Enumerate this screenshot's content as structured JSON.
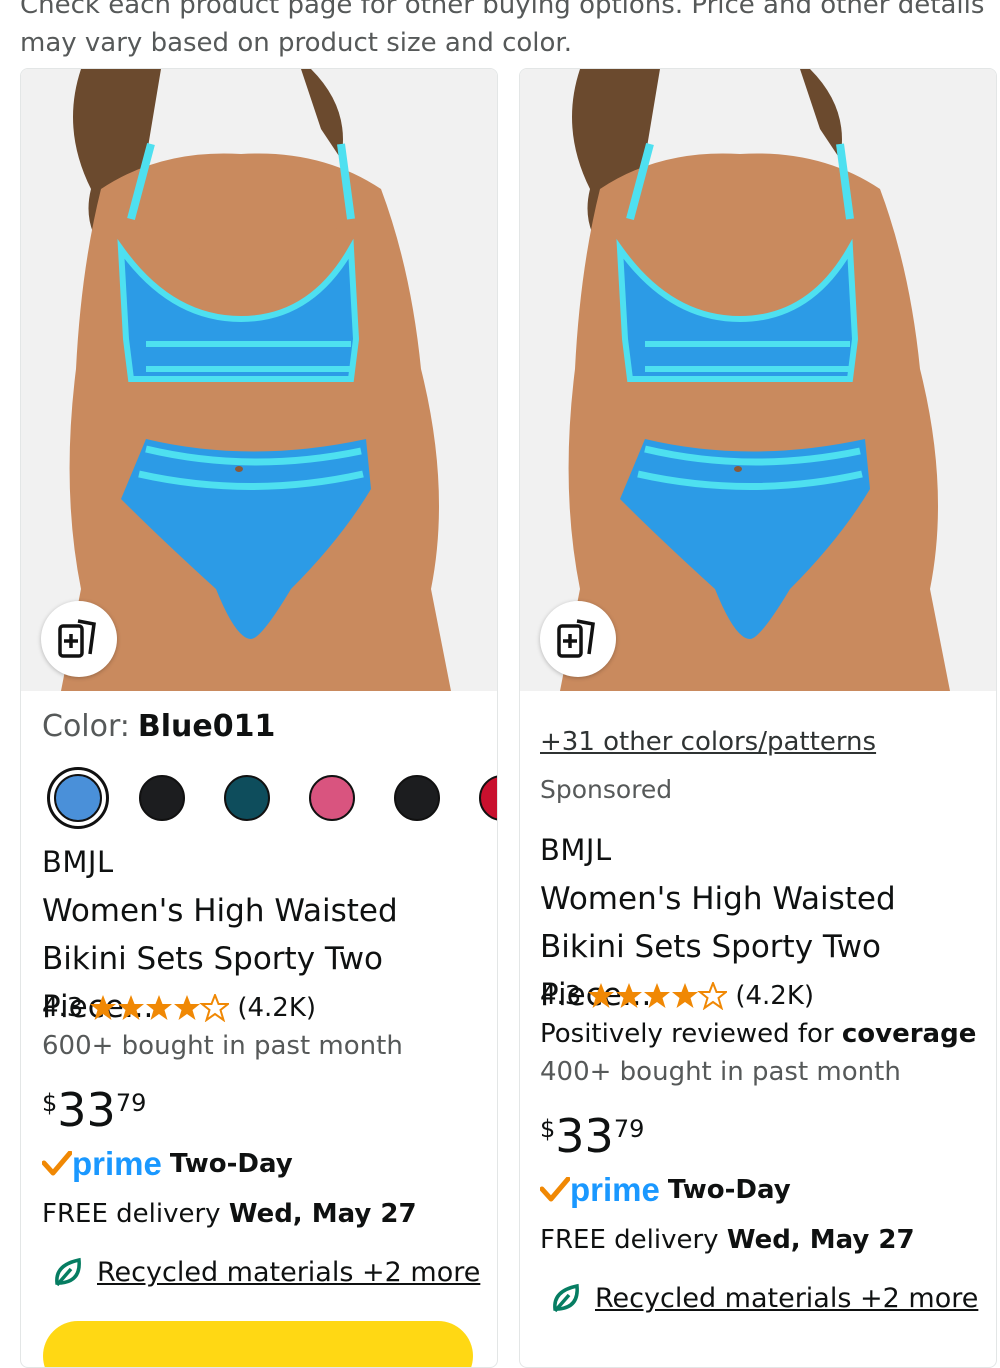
{
  "notice": "Check each product page for other buying options. Price and other details may vary based on product size and color.",
  "left": {
    "compare_icon": "compare-add-icon",
    "color_label": "Color:",
    "color_value": "Blue011",
    "swatches": [
      {
        "color": "#4a90d9",
        "selected": true
      },
      {
        "color": "#1c1d1f"
      },
      {
        "color": "#0e4d5c"
      },
      {
        "color": "#d9547f"
      },
      {
        "color": "#1c1d1f"
      },
      {
        "color": "#c8102e"
      }
    ],
    "brand": "BMJL",
    "title": "Women's High Waisted Bikini Sets Sporty Two Piece...",
    "rating": "4.3",
    "rating_value": 4.3,
    "rating_count": "(4.2K)",
    "bought": "600+ bought in past month",
    "price_currency": "$",
    "price_whole": "33",
    "price_fraction": "79",
    "prime_label": "prime",
    "prime_speed": "Two-Day",
    "delivery_prefix": "FREE delivery",
    "delivery_date": "Wed, May 27",
    "recycled": "Recycled materials +2 more"
  },
  "right": {
    "compare_icon": "compare-add-icon",
    "more_colors": "+31 other colors/patterns",
    "sponsored": "Sponsored",
    "brand": "BMJL",
    "title": "Women's High Waisted Bikini Sets Sporty Two Piece...",
    "rating": "4.3",
    "rating_value": 4.3,
    "rating_count": "(4.2K)",
    "reviewed_prefix": "Positively reviewed for",
    "reviewed_topic": "coverage",
    "bought": "400+ bought in past month",
    "price_currency": "$",
    "price_whole": "33",
    "price_fraction": "79",
    "prime_label": "prime",
    "prime_speed": "Two-Day",
    "delivery_prefix": "FREE delivery",
    "delivery_date": "Wed, May 27",
    "recycled": "Recycled materials +2 more"
  },
  "colors": {
    "accent_blue": "#1a98ff",
    "prime_check": "#f08804",
    "star": "#f08804",
    "add_to_cart": "#ffd814"
  }
}
